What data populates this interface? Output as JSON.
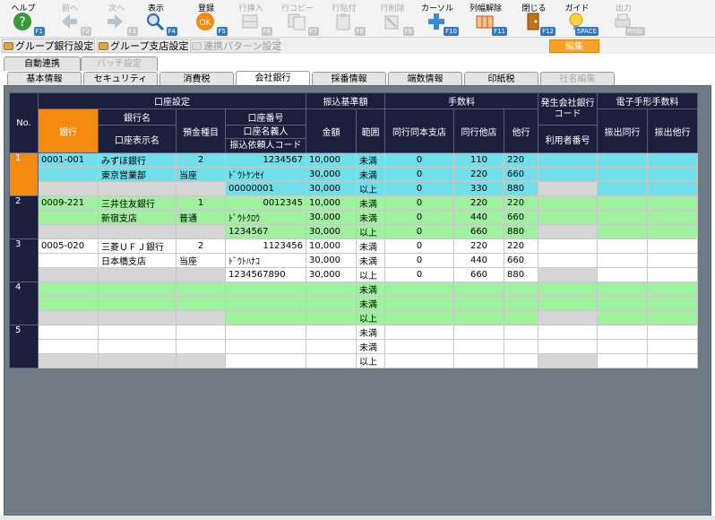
{
  "toolbar": [
    {
      "label": "ヘルプ",
      "fkey": "F1",
      "icon": "help-icon",
      "enabled": true
    },
    {
      "label": "前へ",
      "fkey": "F2",
      "icon": "prev-arrow-icon",
      "enabled": false
    },
    {
      "label": "次へ",
      "fkey": "F3",
      "icon": "next-arrow-icon",
      "enabled": false
    },
    {
      "label": "表示",
      "fkey": "F4",
      "icon": "magnifier-icon",
      "enabled": true
    },
    {
      "label": "登録",
      "fkey": "F5",
      "icon": "ok-icon",
      "enabled": true
    },
    {
      "label": "行挿入",
      "fkey": "F6",
      "icon": "insert-row-icon",
      "enabled": false
    },
    {
      "label": "行コピー",
      "fkey": "F7",
      "icon": "copy-row-icon",
      "enabled": false
    },
    {
      "label": "行貼付",
      "fkey": "F8",
      "icon": "paste-row-icon",
      "enabled": false
    },
    {
      "label": "行削除",
      "fkey": "F9",
      "icon": "delete-row-icon",
      "enabled": false
    },
    {
      "label": "カーソル",
      "fkey": "F10",
      "icon": "cursor-icon",
      "enabled": true
    },
    {
      "label": "列幅解除",
      "fkey": "F11",
      "icon": "column-width-icon",
      "enabled": true
    },
    {
      "label": "閉じる",
      "fkey": "F12",
      "icon": "close-door-icon",
      "enabled": true
    },
    {
      "label": "ガイド",
      "fkey": "SPACE",
      "icon": "lightbulb-icon",
      "enabled": true
    },
    {
      "label": "出力",
      "fkey": "PrtSc",
      "icon": "printer-icon",
      "enabled": false
    }
  ],
  "subtoolbar": {
    "group_bank": "グループ銀行設定",
    "group_branch": "グループ支店設定",
    "link_pattern": "連携パターン設定",
    "edit": "編集"
  },
  "tabs_top": [
    {
      "label": "自動連携",
      "enabled": true
    },
    {
      "label": "バッチ設定",
      "enabled": false
    }
  ],
  "tabs_main": [
    {
      "label": "基本情報",
      "enabled": true
    },
    {
      "label": "セキュリティ",
      "enabled": true
    },
    {
      "label": "消費税",
      "enabled": true
    },
    {
      "label": "会社銀行",
      "enabled": true,
      "selected": true
    },
    {
      "label": "採番情報",
      "enabled": true
    },
    {
      "label": "端数情報",
      "enabled": true
    },
    {
      "label": "印紙税",
      "enabled": true
    },
    {
      "label": "社名編集",
      "enabled": false
    }
  ],
  "grid": {
    "h_no": "No.",
    "h_account_settings": "口座設定",
    "h_transfer_threshold": "振込基準額",
    "h_fee": "手数料",
    "h_issuer_bank_code": "発生会社銀行コード",
    "h_edi_fee": "電子手形手数料",
    "h_bank": "銀行",
    "h_bank_name": "銀行名",
    "h_display_name": "口座表示名",
    "h_deposit_type": "預金種目",
    "h_account_no": "口座番号",
    "h_account_holder": "口座名義人",
    "h_requester_code": "振込依頼人コード",
    "h_amount": "金額",
    "h_range": "範囲",
    "h_same_bank_branch": "同行同本支店",
    "h_same_bank_other": "同行他店",
    "h_other_bank": "他行",
    "h_user_no": "利用者番号",
    "h_issue_same": "振出同行",
    "h_issue_other": "振出他行",
    "records": [
      {
        "no": "1",
        "style": "cyan",
        "bank": "0001-001",
        "lines": [
          {
            "name": "みずほ銀行",
            "type": "2",
            "acct": "1234567",
            "amount": "10,000",
            "range": "未満",
            "f1": "0",
            "f2": "110",
            "f3": "220"
          },
          {
            "name": "東京営業部",
            "type": "当座",
            "acct": "ﾄﾞｳﾄｹﾝｾｲ",
            "amount": "30,000",
            "range": "未満",
            "f1": "0",
            "f2": "220",
            "f3": "660"
          },
          {
            "name": "",
            "type": "",
            "acct": "00000001",
            "amount": "30,000",
            "range": "以上",
            "f1": "0",
            "f2": "330",
            "f3": "880"
          }
        ]
      },
      {
        "no": "2",
        "style": "green",
        "bank": "0009-221",
        "lines": [
          {
            "name": "三井住友銀行",
            "type": "1",
            "acct": "0012345",
            "amount": "10,000",
            "range": "未満",
            "f1": "0",
            "f2": "220",
            "f3": "220"
          },
          {
            "name": "新宿支店",
            "type": "普通",
            "acct": "ﾄﾞｳﾄｸﾛｳ",
            "amount": "30,000",
            "range": "未満",
            "f1": "0",
            "f2": "440",
            "f3": "660"
          },
          {
            "name": "",
            "type": "",
            "acct": "1234567",
            "amount": "30,000",
            "range": "以上",
            "f1": "0",
            "f2": "660",
            "f3": "880"
          }
        ]
      },
      {
        "no": "3",
        "style": "white",
        "bank": "0005-020",
        "lines": [
          {
            "name": "三菱ＵＦＪ銀行",
            "type": "2",
            "acct": "1123456",
            "amount": "10,000",
            "range": "未満",
            "f1": "0",
            "f2": "220",
            "f3": "220"
          },
          {
            "name": "日本橋支店",
            "type": "当座",
            "acct": "ﾄﾞｳﾄﾊﾅｺ",
            "amount": "30,000",
            "range": "未満",
            "f1": "0",
            "f2": "440",
            "f3": "660"
          },
          {
            "name": "",
            "type": "",
            "acct": "1234567890",
            "amount": "30,000",
            "range": "以上",
            "f1": "0",
            "f2": "660",
            "f3": "880"
          }
        ]
      },
      {
        "no": "4",
        "style": "green",
        "bank": "",
        "lines": [
          {
            "name": "",
            "type": "",
            "acct": "",
            "amount": "",
            "range": "未満",
            "f1": "",
            "f2": "",
            "f3": ""
          },
          {
            "name": "",
            "type": "",
            "acct": "",
            "amount": "",
            "range": "未満",
            "f1": "",
            "f2": "",
            "f3": ""
          },
          {
            "name": "",
            "type": "",
            "acct": "",
            "amount": "",
            "range": "以上",
            "f1": "",
            "f2": "",
            "f3": ""
          }
        ]
      },
      {
        "no": "5",
        "style": "white",
        "bank": "",
        "lines": [
          {
            "name": "",
            "type": "",
            "acct": "",
            "amount": "",
            "range": "未満",
            "f1": "",
            "f2": "",
            "f3": ""
          },
          {
            "name": "",
            "type": "",
            "acct": "",
            "amount": "",
            "range": "未満",
            "f1": "",
            "f2": "",
            "f3": ""
          },
          {
            "name": "",
            "type": "",
            "acct": "",
            "amount": "",
            "range": "以上",
            "f1": "",
            "f2": "",
            "f3": ""
          }
        ]
      }
    ]
  }
}
